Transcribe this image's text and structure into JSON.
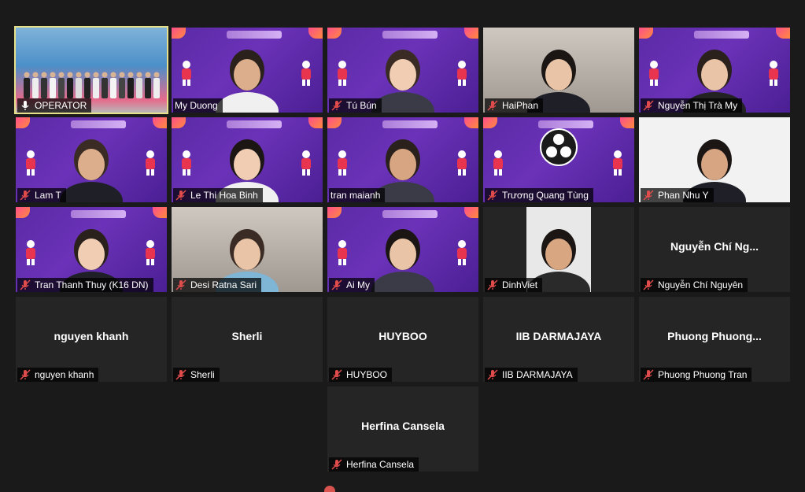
{
  "app": "Zoom gallery view",
  "colors": {
    "background": "#1a1a1a",
    "tile": "#252525",
    "active_border": "#e7e08a",
    "mic_muted": "#e04b4b"
  },
  "participants": [
    {
      "name": "OPERATOR",
      "video": "stage",
      "active": true,
      "muted": false,
      "mic_icon": "unmuted-mic-icon"
    },
    {
      "name": "My Duong",
      "video": "banner",
      "muted": false,
      "mic_icon": "none"
    },
    {
      "name": "Tú Bún",
      "video": "banner",
      "muted": true
    },
    {
      "name": "HaiPhan",
      "video": "room",
      "muted": true
    },
    {
      "name": "Nguyễn Thị Trà My",
      "video": "banner",
      "muted": true
    },
    {
      "name": "Lam T",
      "video": "banner",
      "muted": true
    },
    {
      "name": "Le Thi Hoa Binh",
      "video": "banner",
      "muted": true
    },
    {
      "name": "tran maianh",
      "video": "banner",
      "muted": false,
      "mic_icon": "none"
    },
    {
      "name": "Trương Quang Tùng",
      "video": "banner-obs",
      "muted": true
    },
    {
      "name": "Phan Nhu Y",
      "video": "white",
      "muted": true
    },
    {
      "name": "Tran Thanh Thuy (K16 DN)",
      "video": "banner",
      "muted": true
    },
    {
      "name": "Desi Ratna Sari",
      "video": "room",
      "muted": true
    },
    {
      "name": "Ai My",
      "video": "banner",
      "muted": true
    },
    {
      "name": "DinhViet",
      "video": "white-narrow",
      "muted": true
    },
    {
      "name": "Nguyễn Chí Nguyên",
      "video": "none",
      "center_label": "Nguyễn Chí Ng...",
      "muted": true
    },
    {
      "name": "nguyen khanh",
      "video": "none",
      "center_label": "nguyen khanh",
      "muted": true
    },
    {
      "name": "Sherli",
      "video": "none",
      "center_label": "Sherli",
      "muted": true
    },
    {
      "name": "HUYBOO",
      "video": "none",
      "center_label": "HUYBOO",
      "muted": true
    },
    {
      "name": "IIB DARMAJAYA",
      "video": "none",
      "center_label": "IIB DARMAJAYA",
      "muted": true
    },
    {
      "name": "Phuong Phuong Tran",
      "video": "none",
      "center_label": "Phuong  Phuong...",
      "muted": true
    },
    {
      "name": "Herfina Cansela",
      "video": "none",
      "center_label": "Herfina Cansela",
      "muted": true
    }
  ]
}
